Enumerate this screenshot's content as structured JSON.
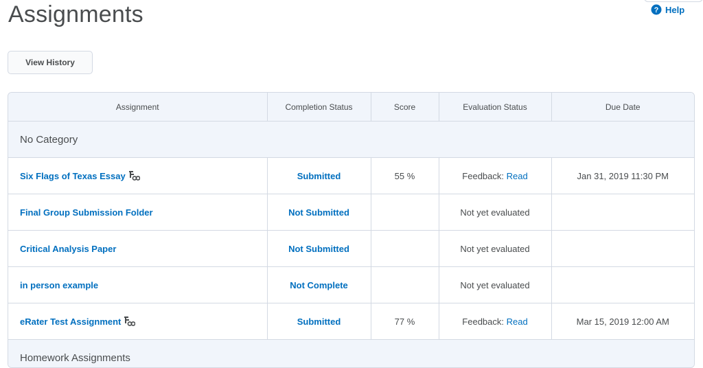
{
  "page": {
    "title": "Assignments",
    "help_label": "Help"
  },
  "toolbar": {
    "view_history_label": "View History"
  },
  "table": {
    "headers": {
      "assignment": "Assignment",
      "completion": "Completion Status",
      "score": "Score",
      "evaluation": "Evaluation Status",
      "due": "Due Date"
    },
    "categories": [
      "No Category",
      "Homework Assignments"
    ],
    "rows": [
      {
        "name": "Six Flags of Texas Essay",
        "completion": "Submitted",
        "score": "55 %",
        "eval_prefix": "Feedback: ",
        "eval_link": "Read",
        "eval_text": "",
        "due": "Jan 31, 2019 11:30 PM"
      },
      {
        "name": "Final Group Submission Folder",
        "completion": "Not Submitted",
        "score": "",
        "eval_prefix": "",
        "eval_link": "",
        "eval_text": "Not yet evaluated",
        "due": ""
      },
      {
        "name": "Critical Analysis Paper",
        "completion": "Not Submitted",
        "score": "",
        "eval_prefix": "",
        "eval_link": "",
        "eval_text": "Not yet evaluated",
        "due": ""
      },
      {
        "name": "in person example",
        "completion": "Not Complete",
        "score": "",
        "eval_prefix": "",
        "eval_link": "",
        "eval_text": "Not yet evaluated",
        "due": ""
      },
      {
        "name": "eRater Test Assignment",
        "completion": "Submitted",
        "score": "77 %",
        "eval_prefix": "Feedback: ",
        "eval_link": "Read",
        "eval_text": "",
        "due": "Mar 15, 2019 12:00 AM"
      }
    ]
  },
  "colors": {
    "link": "#006fbf",
    "text": "#494c4e",
    "header_bg": "#f1f5fb",
    "border": "#d3d9e3"
  },
  "icons": {
    "help": "help-circle-icon",
    "turnitin": "turnitin-icon"
  }
}
